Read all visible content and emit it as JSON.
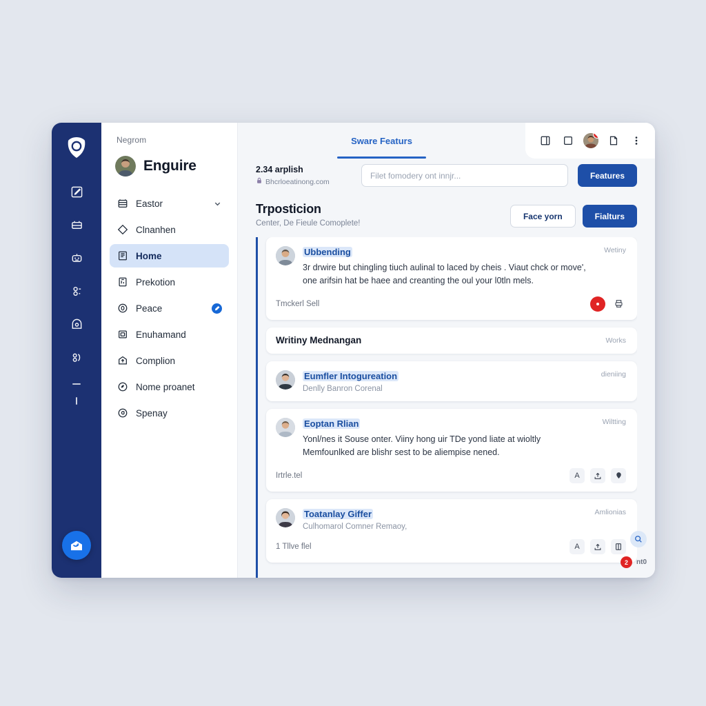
{
  "rail": {
    "logo_icon": "shield-refresh-logo",
    "icons": [
      {
        "name": "compose-icon"
      },
      {
        "name": "inbox-icon"
      },
      {
        "name": "robot-icon"
      },
      {
        "name": "workflow-icon"
      },
      {
        "name": "archive-icon"
      },
      {
        "name": "contacts-icon"
      }
    ],
    "fab_icon": "mail-open-icon"
  },
  "sidebar": {
    "brand": "Negrom",
    "user": {
      "name": "Enguire",
      "avatar": "user-avatar"
    },
    "items": [
      {
        "label": "Eastor",
        "icon": "calendar-icon",
        "active": false,
        "trailing": "chevron"
      },
      {
        "label": "Clnanhen",
        "icon": "diamond-icon",
        "active": false,
        "trailing": "none"
      },
      {
        "label": "Home",
        "icon": "book-icon",
        "active": true,
        "trailing": "none"
      },
      {
        "label": "Prekotion",
        "icon": "document-icon",
        "active": false,
        "trailing": "none"
      },
      {
        "label": "Peace",
        "icon": "zero-circle-icon",
        "active": false,
        "trailing": "dot"
      },
      {
        "label": "Enuhamand",
        "icon": "card-icon",
        "active": false,
        "trailing": "none"
      },
      {
        "label": "Complion",
        "icon": "upload-box-icon",
        "active": false,
        "trailing": "none"
      },
      {
        "label": "Nome proanet",
        "icon": "leaf-circle-icon",
        "active": false,
        "trailing": "none"
      },
      {
        "label": "Spenay",
        "icon": "at-circle-icon",
        "active": false,
        "trailing": "none"
      }
    ]
  },
  "topbar": {
    "tabs": [
      {
        "label": "Sware Featurs",
        "active": true
      }
    ],
    "actions": [
      {
        "name": "layout-panel-icon"
      },
      {
        "name": "square-icon"
      },
      {
        "name": "account-avatar",
        "badge": "1"
      },
      {
        "name": "file-icon"
      },
      {
        "name": "more-vertical-icon"
      }
    ]
  },
  "filterbar": {
    "title": "2.34 arplish",
    "subtitle": "Bhcrloeatinong.com",
    "subtitle_icon": "lock-icon",
    "search_placeholder": "Filet fomodery ont innjr...",
    "search_value": "",
    "action_label": "Features"
  },
  "page": {
    "title": "Trposticion",
    "subtitle": "Center, De Fieule Comoplete!",
    "secondary_button": "Face yorn",
    "primary_button": "Fialturs"
  },
  "feed": [
    {
      "kind": "card",
      "name": "Ubbending",
      "status": "Wetiny",
      "text": "3r drwire but chingling tiuch aulinal to laced by cheis . Viaut chck or move', one arifsin hat be haee and creanting the oul your l0tln mels.",
      "foot_label": "Tmckerl Sell",
      "actions": [
        {
          "name": "record-icon",
          "glyph": "●",
          "style": "rec"
        },
        {
          "name": "print-icon",
          "glyph": "⎙",
          "style": "plain"
        }
      ]
    },
    {
      "kind": "banner",
      "title": "Writiny Mednangan",
      "status": "Works"
    },
    {
      "kind": "card-compact",
      "name": "Eumfler Intogureation",
      "status": "dieniing",
      "sub": "Denlly Banron Corenal"
    },
    {
      "kind": "card",
      "name": "Eoptan Rlian",
      "status": "Wiltting",
      "text": "Yonl/nes it Souse onter. Viiny hong uir TDe yond liate at wioltly Memfounlked are blishr sest to be aliempise nened.",
      "foot_label": "Irtrle.tel",
      "actions": [
        {
          "name": "text-format-icon",
          "glyph": "A",
          "style": ""
        },
        {
          "name": "upload-icon",
          "glyph": "⎙",
          "style": ""
        },
        {
          "name": "location-pin-icon",
          "glyph": "♥",
          "style": ""
        }
      ]
    },
    {
      "kind": "card",
      "name": "Toatanlay Giffer",
      "status": "Amlionias",
      "sub": "Culhomarol Comner Remaoy,",
      "foot_label": "1 Tllve flel",
      "actions": [
        {
          "name": "text-format-icon",
          "glyph": "A",
          "style": ""
        },
        {
          "name": "upload-icon",
          "glyph": "⎙",
          "style": ""
        },
        {
          "name": "attachment-icon",
          "glyph": "◫",
          "style": ""
        }
      ]
    }
  ],
  "floating": {
    "search_icon": "search-icon",
    "badge_count": "2",
    "label": "nt0"
  },
  "colors": {
    "rail_bg": "#1c3172",
    "accent_blue": "#1e4fa8",
    "tab_blue": "#2563c4",
    "active_nav_bg": "#d5e3f8",
    "danger_red": "#e02424",
    "page_bg": "#f4f6f9",
    "outer_bg": "#e3e7ee"
  }
}
